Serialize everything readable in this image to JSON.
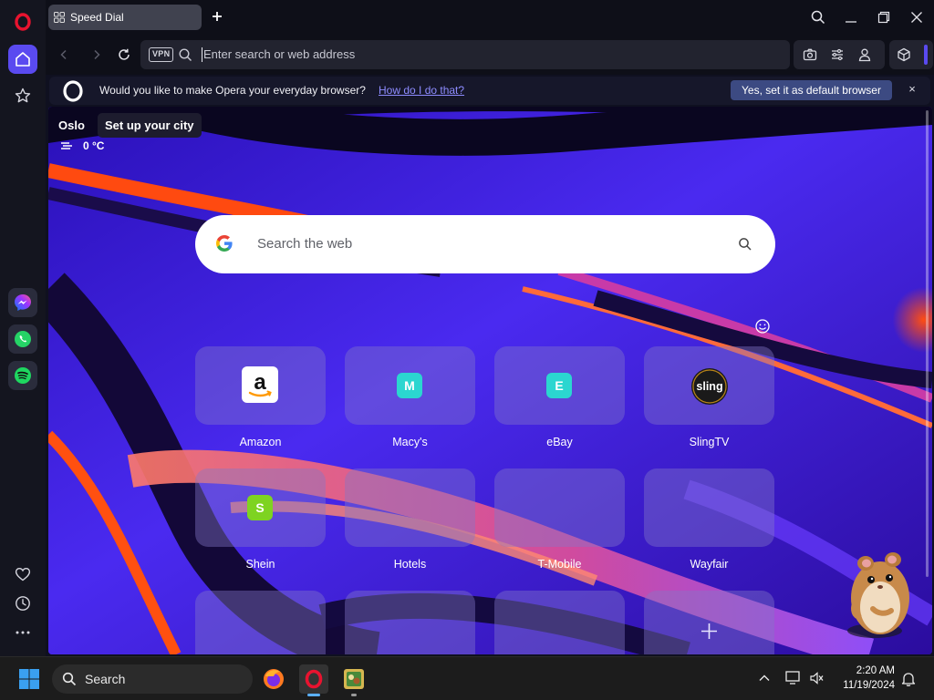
{
  "browser": {
    "tab_title": "Speed Dial",
    "address_placeholder": "Enter search or web address",
    "vpn_label": "VPN"
  },
  "prompt": {
    "message": "Would you like to make Opera your everyday browser?",
    "link": "How do I do that?",
    "button": "Yes, set it as default browser",
    "close": "×"
  },
  "weather": {
    "city": "Oslo",
    "tooltip": "Set up your city",
    "temperature": "0 °C"
  },
  "search": {
    "placeholder": "Search the web"
  },
  "speed_dial": [
    {
      "label": "Amazon",
      "icon": "amazon-logo",
      "letter": "a",
      "color": "#ffffff"
    },
    {
      "label": "Macy's",
      "icon": "letter-tile",
      "letter": "M",
      "color": "#2bd6d0"
    },
    {
      "label": "eBay",
      "icon": "letter-tile",
      "letter": "E",
      "color": "#2bd6d0"
    },
    {
      "label": "SlingTV",
      "icon": "sling-logo",
      "letter": "sling",
      "color": "#1a1a1a"
    },
    {
      "label": "Shein",
      "icon": "letter-tile",
      "letter": "S",
      "color": "#7ed321"
    },
    {
      "label": "Hotels",
      "icon": "",
      "letter": "",
      "color": ""
    },
    {
      "label": "T-Mobile",
      "icon": "",
      "letter": "",
      "color": ""
    },
    {
      "label": "Wayfair",
      "icon": "",
      "letter": "",
      "color": ""
    }
  ],
  "taskbar": {
    "search_label": "Search",
    "time": "2:20 AM",
    "date": "11/19/2024"
  },
  "colors": {
    "accent": "#5a4af0",
    "opera_red": "#e8132f",
    "background_violet": "#3a1fd6",
    "background_orange": "#ff5a1f"
  }
}
